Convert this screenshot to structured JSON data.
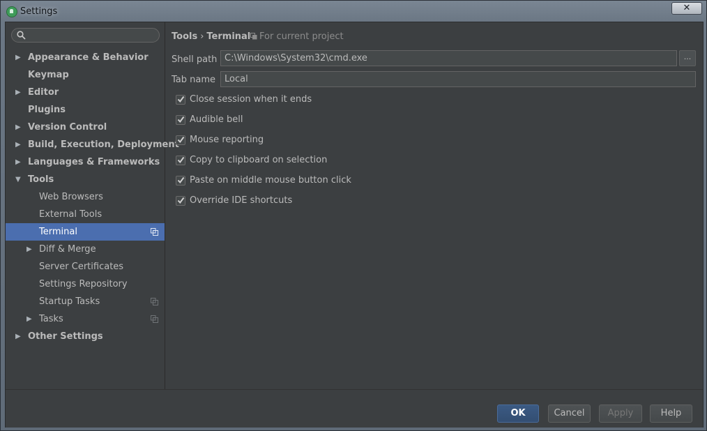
{
  "window": {
    "title": "Settings",
    "close_glyph": "✕"
  },
  "search": {
    "value": "",
    "placeholder": ""
  },
  "sidebar": {
    "items": [
      {
        "label": "Appearance & Behavior",
        "level": 0,
        "expandable": true,
        "expanded": false
      },
      {
        "label": "Keymap",
        "level": 0,
        "expandable": false
      },
      {
        "label": "Editor",
        "level": 0,
        "expandable": true,
        "expanded": false
      },
      {
        "label": "Plugins",
        "level": 0,
        "expandable": false
      },
      {
        "label": "Version Control",
        "level": 0,
        "expandable": true,
        "expanded": false
      },
      {
        "label": "Build, Execution, Deployment",
        "level": 0,
        "expandable": true,
        "expanded": false
      },
      {
        "label": "Languages & Frameworks",
        "level": 0,
        "expandable": true,
        "expanded": false
      },
      {
        "label": "Tools",
        "level": 0,
        "expandable": true,
        "expanded": true
      },
      {
        "label": "Web Browsers",
        "level": 1,
        "expandable": false
      },
      {
        "label": "External Tools",
        "level": 1,
        "expandable": false
      },
      {
        "label": "Terminal",
        "level": 1,
        "expandable": false,
        "selected": true,
        "project_icon": "copy-icon"
      },
      {
        "label": "Diff & Merge",
        "level": 1,
        "expandable": true,
        "expanded": false
      },
      {
        "label": "Server Certificates",
        "level": 1,
        "expandable": false
      },
      {
        "label": "Settings Repository",
        "level": 1,
        "expandable": false
      },
      {
        "label": "Startup Tasks",
        "level": 1,
        "expandable": false,
        "project_icon": "copy-icon"
      },
      {
        "label": "Tasks",
        "level": 1,
        "expandable": true,
        "expanded": false,
        "project_icon": "copy-icon"
      },
      {
        "label": "Other Settings",
        "level": 0,
        "expandable": true,
        "expanded": false
      }
    ]
  },
  "main": {
    "breadcrumb": {
      "parent": "Tools",
      "separator": "›",
      "current": "Terminal"
    },
    "scope_label": "For current project",
    "fields": {
      "shell_path": {
        "label": "Shell path",
        "value": "C:\\Windows\\System32\\cmd.exe",
        "browse_label": "..."
      },
      "tab_name": {
        "label": "Tab name",
        "value": "Local"
      }
    },
    "checkboxes": [
      {
        "label": "Close session when it ends",
        "checked": true
      },
      {
        "label": "Audible bell",
        "checked": true
      },
      {
        "label": "Mouse reporting",
        "checked": true
      },
      {
        "label": "Copy to clipboard on selection",
        "checked": true
      },
      {
        "label": "Paste on middle mouse button click",
        "checked": true
      },
      {
        "label": "Override IDE shortcuts",
        "checked": true
      }
    ]
  },
  "footer": {
    "ok": "OK",
    "cancel": "Cancel",
    "apply": "Apply",
    "help": "Help"
  },
  "colors": {
    "background": "#3c3f41",
    "selection": "#4b6eaf",
    "text": "#bbbbbb",
    "ok_button": "#365880"
  }
}
